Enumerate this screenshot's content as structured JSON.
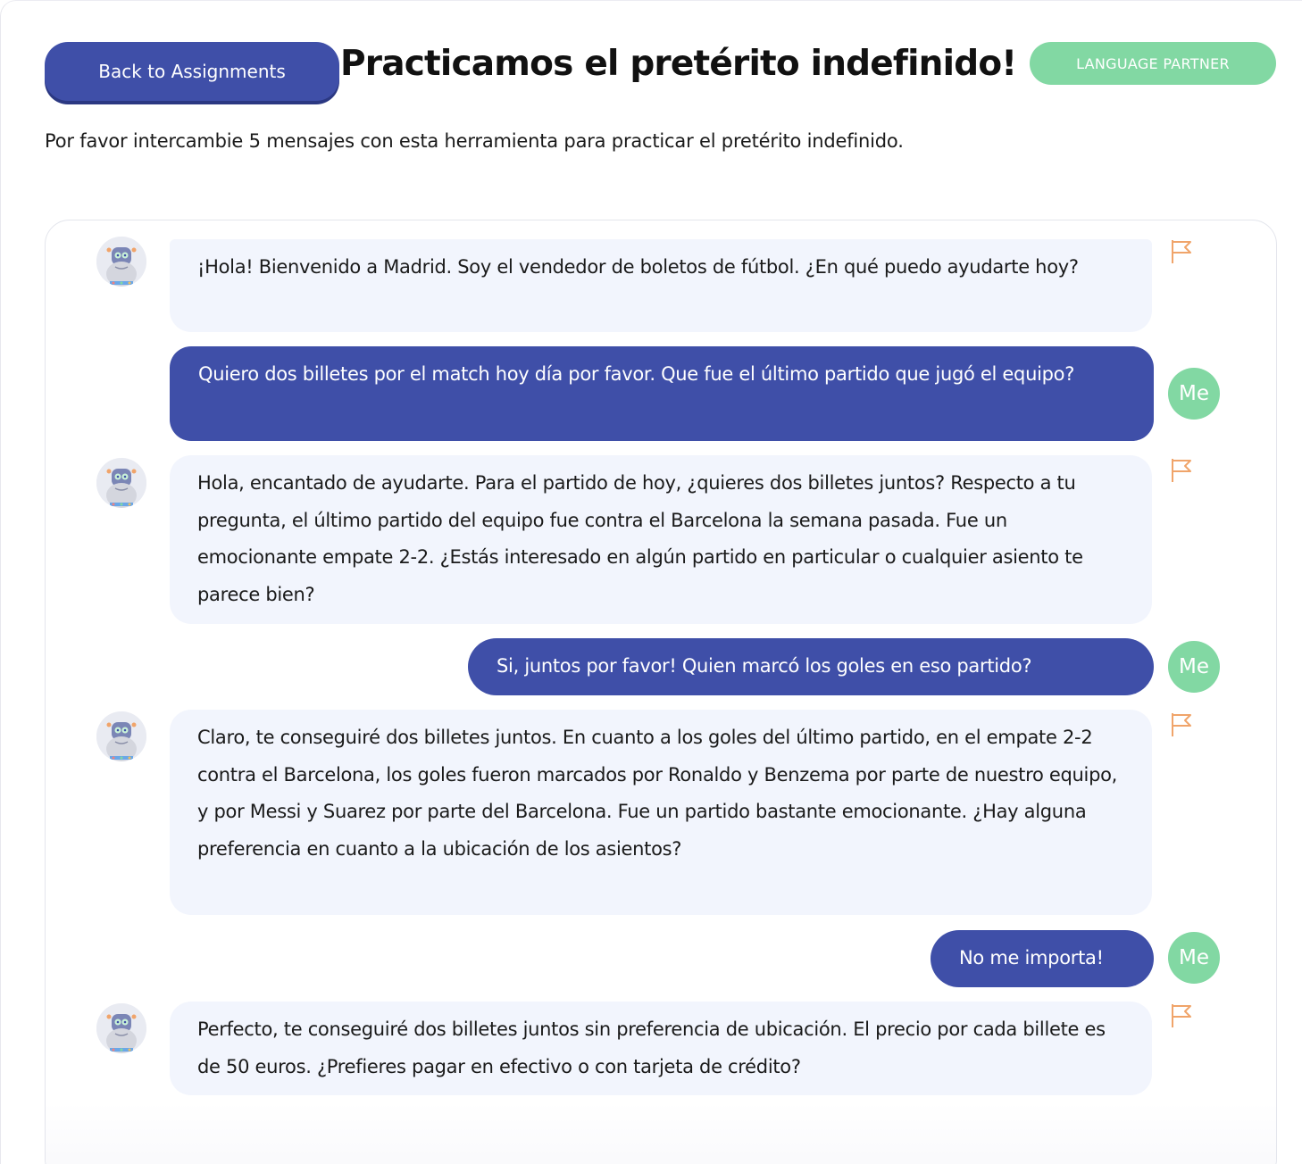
{
  "header": {
    "back_label": "Back to Assignments",
    "title": "Practicamos el pretérito indefinido!",
    "badge": "LANGUAGE PARTNER",
    "instructions": "Por favor intercambie 5 mensajes con esta herramienta para practicar el pretérito indefinido."
  },
  "colors": {
    "primary": "#3f4fa8",
    "accent_green": "#82d8a3",
    "bot_bubble": "#f2f5fd",
    "flag": "#f0a46a"
  },
  "icons": {
    "bot_avatar": "robot-avatar-icon",
    "flag": "flag-icon"
  },
  "messages": [
    {
      "sender": "bot",
      "text": "¡Hola! Bienvenido a Madrid. Soy el vendedor de boletos de fútbol. ¿En qué puedo ayudarte hoy?"
    },
    {
      "sender": "user",
      "avatar_label": "Me",
      "text": "Quiero dos billetes por el match hoy día por favor. Que fue el último partido que jugó el equipo?"
    },
    {
      "sender": "bot",
      "text": "Hola, encantado de ayudarte. Para el partido de hoy, ¿quieres dos billetes juntos? Respecto a tu pregunta, el último partido del equipo fue contra el Barcelona la semana pasada. Fue un emocionante empate 2-2. ¿Estás interesado en algún partido en particular o cualquier asiento te parece bien?"
    },
    {
      "sender": "user",
      "avatar_label": "Me",
      "text": "Si, juntos por favor! Quien marcó los goles en eso partido?"
    },
    {
      "sender": "bot",
      "text": "Claro, te conseguiré dos billetes juntos. En cuanto a los goles del último partido, en el empate 2-2 contra el Barcelona, los goles fueron marcados por Ronaldo y Benzema por parte de nuestro equipo, y por Messi y Suarez por parte del Barcelona. Fue un partido bastante emocionante. ¿Hay alguna preferencia en cuanto a la ubicación de los asientos?"
    },
    {
      "sender": "user",
      "avatar_label": "Me",
      "text": "No me importa!"
    },
    {
      "sender": "bot",
      "text": "Perfecto, te conseguiré dos billetes juntos sin preferencia de ubicación. El precio por cada billete es de 50 euros. ¿Prefieres pagar en efectivo o con tarjeta de crédito?"
    }
  ]
}
